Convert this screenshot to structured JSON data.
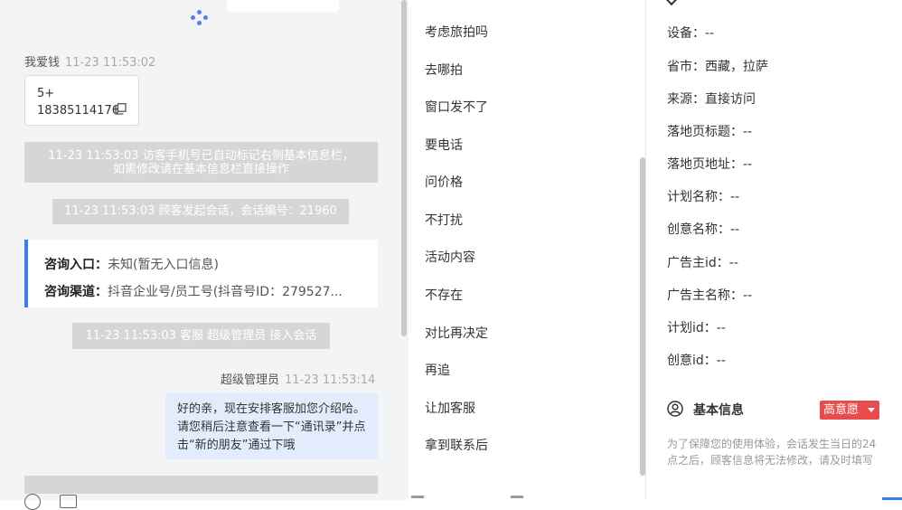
{
  "chat": {
    "m1": {
      "sender": "我爱钱",
      "time": "11-23 11:53:02",
      "line1": "5+",
      "line2": "18385114176"
    },
    "sys1": {
      "line1": "11-23 11:53:03 访客手机号已自动标记右侧基本信息栏，",
      "line2": "如需修改请在基本信息栏直接操作"
    },
    "sys2": "11-23 11:53:03 顾客发起会话，会话编号：21960",
    "entry": {
      "label1": "咨询入口：",
      "value1": "未知(暂无入口信息)",
      "label2": "咨询渠道：",
      "value2": "抖音企业号/员工号(抖音号ID：279527..."
    },
    "sys3": "11-23 11:53:03 客服 超级管理员 接入会话",
    "m2": {
      "sender": "超级管理员",
      "time": "11-23 11:53:14",
      "text": "好的亲，现在安排客服加您介绍哈。请您稍后注意查看一下“通讯录”并点击“新的朋友”通过下哦"
    }
  },
  "quick_replies": [
    "考虑旅拍吗",
    "去哪拍",
    "窗口发不了",
    "要电话",
    "问价格",
    "不打扰",
    "活动内容",
    "不存在",
    "对比再决定",
    "再追",
    "让加客服",
    "拿到联系后"
  ],
  "info": {
    "fields": [
      {
        "label": "设备：",
        "value": "--"
      },
      {
        "label": "省市：",
        "value": "西藏，拉萨"
      },
      {
        "label": "来源：",
        "value": "直接访问"
      },
      {
        "label": "落地页标题：",
        "value": "--"
      },
      {
        "label": "落地页地址：",
        "value": "--"
      },
      {
        "label": "计划名称：",
        "value": "--"
      },
      {
        "label": "创意名称：",
        "value": "--"
      },
      {
        "label": "广告主id：",
        "value": "--"
      },
      {
        "label": "广告主名称：",
        "value": "--"
      },
      {
        "label": "计划id：",
        "value": "--"
      },
      {
        "label": "创意id：",
        "value": "--"
      }
    ],
    "section_title": "基本信息",
    "intent_badge": "高意愿",
    "note": "为了保障您的使用体验，会话发生当日的24点之后，顾客信息将无法修改，请及时填写"
  },
  "colors": {
    "accent": "#3a7cf6",
    "badge": "#e84c4c",
    "bubble": "#e2ecfc",
    "system": "#d6d6d6"
  },
  "icons": [
    "loading-icon",
    "copy-icon",
    "emoji-icon",
    "folder-icon",
    "user-icon",
    "chevron-down-icon"
  ]
}
